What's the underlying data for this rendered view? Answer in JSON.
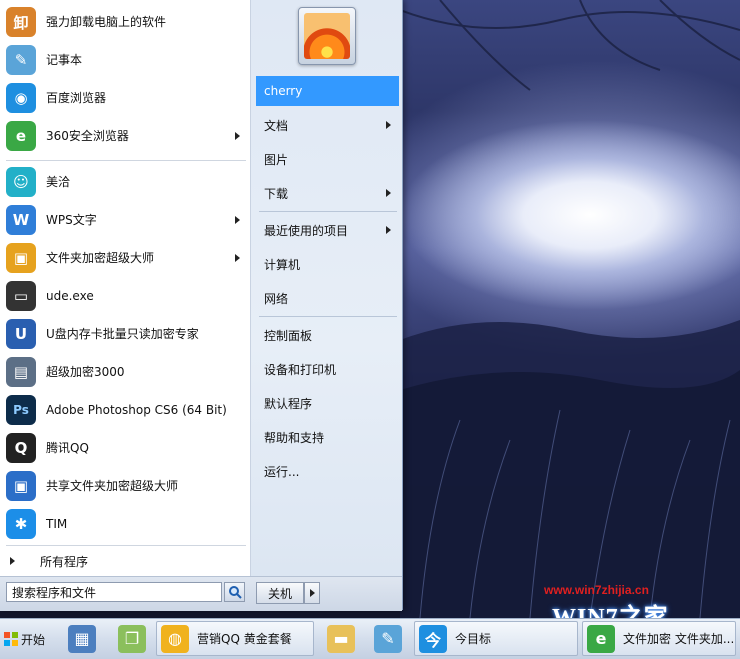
{
  "start_menu": {
    "programs": [
      {
        "label": "强力卸载电脑上的软件",
        "icon": "uninstall-icon",
        "submenu": false,
        "color": "#d9822b"
      },
      {
        "label": "记事本",
        "icon": "notepad-icon",
        "submenu": false,
        "color": "#5aa4d8"
      },
      {
        "label": "百度浏览器",
        "icon": "baidu-browser-icon",
        "submenu": false,
        "color": "#1e8fe0"
      },
      {
        "label": "360安全浏览器",
        "icon": "360-browser-icon",
        "submenu": true,
        "color": "#3aa845"
      },
      {
        "label": "美洽",
        "icon": "meiqia-icon",
        "submenu": false,
        "color": "#22b0c8"
      },
      {
        "label": "WPS文字",
        "icon": "wps-writer-icon",
        "submenu": true,
        "color": "#2f7ed8"
      },
      {
        "label": "文件夹加密超级大师",
        "icon": "folder-encrypt-icon",
        "submenu": true,
        "color": "#e6a21e"
      },
      {
        "label": "ude.exe",
        "icon": "computer-icon",
        "submenu": false,
        "color": "#333333"
      },
      {
        "label": "U盘内存卡批量只读加密专家",
        "icon": "usb-encrypt-icon",
        "submenu": false,
        "color": "#2a5fb0"
      },
      {
        "label": "超级加密3000",
        "icon": "super-encrypt-icon",
        "submenu": false,
        "color": "#5c6f86"
      },
      {
        "label": "Adobe Photoshop CS6 (64 Bit)",
        "icon": "photoshop-icon",
        "submenu": false,
        "color": "#0d2c4a"
      },
      {
        "label": "腾讯QQ",
        "icon": "qq-penguin-icon",
        "submenu": false,
        "color": "#222222"
      },
      {
        "label": "共享文件夹加密超级大师",
        "icon": "share-encrypt-icon",
        "submenu": false,
        "color": "#2b6ec8"
      },
      {
        "label": "TIM",
        "icon": "tim-icon",
        "submenu": false,
        "color": "#1c8ee8"
      }
    ],
    "all_programs": "所有程序",
    "search_placeholder": "搜索程序和文件",
    "shutdown_label": "关机",
    "right_items": [
      {
        "label": "cherry",
        "submenu": false,
        "selected": true
      },
      {
        "label": "文档",
        "submenu": true,
        "selected": false
      },
      {
        "label": "图片",
        "submenu": false,
        "selected": false
      },
      {
        "label": "下载",
        "submenu": true,
        "selected": false
      },
      {
        "label": "最近使用的项目",
        "submenu": true,
        "selected": false
      },
      {
        "label": "计算机",
        "submenu": false,
        "selected": false
      },
      {
        "label": "网络",
        "submenu": false,
        "selected": false
      },
      {
        "label": "控制面板",
        "submenu": false,
        "selected": false
      },
      {
        "label": "设备和打印机",
        "submenu": false,
        "selected": false
      },
      {
        "label": "默认程序",
        "submenu": false,
        "selected": false
      },
      {
        "label": "帮助和支持",
        "submenu": false,
        "selected": false
      },
      {
        "label": "运行...",
        "submenu": false,
        "selected": false
      }
    ]
  },
  "taskbar": {
    "start_label": "开始",
    "items": [
      {
        "label": "",
        "icon": "calculator-icon",
        "color": "#4c7fbf"
      },
      {
        "label": "",
        "icon": "window-switch-icon",
        "color": "#8bbf5c"
      },
      {
        "label": "营销QQ 黄金套餐",
        "icon": "marketing-qq-icon",
        "color": "#f0b21e"
      },
      {
        "label": "",
        "icon": "explorer-folder-icon",
        "color": "#e8c15a"
      },
      {
        "label": "",
        "icon": "notepad-icon",
        "color": "#5aa4d8"
      },
      {
        "label": "今目标",
        "icon": "jinmubiao-icon",
        "color": "#1e8fe0"
      },
      {
        "label": "文件加密 文件夹加...",
        "icon": "360-browser-icon",
        "color": "#3aa845"
      }
    ]
  },
  "watermark": {
    "url": "www.win7zhijia.cn",
    "logo": "WIN7之家"
  }
}
